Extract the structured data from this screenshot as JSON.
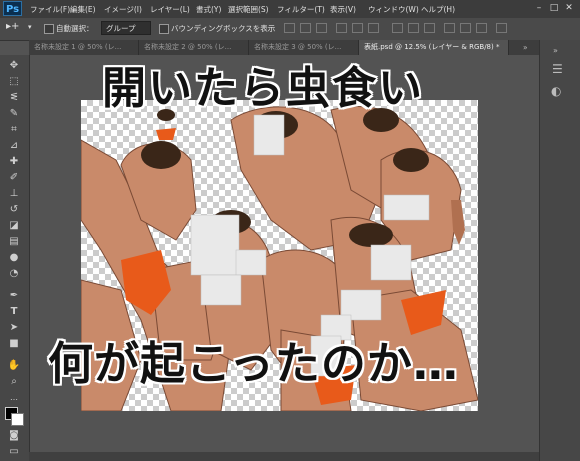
{
  "app": {
    "logo": "Ps"
  },
  "menu": [
    "ファイル(F)",
    "編集(E)",
    "イメージ(I)",
    "レイヤー(L)",
    "書式(Y)",
    "選択範囲(S)",
    "フィルター(T)",
    "表示(V)",
    "ウィンドウ(W)",
    "ヘルプ(H)"
  ],
  "options": {
    "auto_select_label": "自動選択：",
    "auto_select_value": "グループ",
    "bbox_label": "バウンディングボックスを表示"
  },
  "tabs": [
    {
      "label": "名称未設定 1 @ 50% (レ...",
      "active": false
    },
    {
      "label": "名称未設定 2 @ 50% (レ...",
      "active": false
    },
    {
      "label": "名称未設定 3 @ 50% (レ...",
      "active": false
    },
    {
      "label": "表紙.psd @ 12.5% (レイヤー & RGB/8) *",
      "active": true
    }
  ],
  "tools": [
    "move-tool",
    "marquee-tool",
    "lasso-tool",
    "quick-select-tool",
    "crop-tool",
    "eyedropper-tool",
    "healing-tool",
    "brush-tool",
    "stamp-tool",
    "history-brush-tool",
    "eraser-tool",
    "gradient-tool",
    "blur-tool",
    "dodge-tool",
    "pen-tool",
    "type-tool",
    "path-select-tool",
    "shape-tool",
    "hand-tool",
    "zoom-tool"
  ],
  "document": {
    "caption_top": "開いたら虫食い",
    "caption_bottom": "何が起こったのか…"
  },
  "colors": {
    "foreground": "#000000",
    "background": "#ffffff",
    "accent": "#4fb6ff"
  }
}
